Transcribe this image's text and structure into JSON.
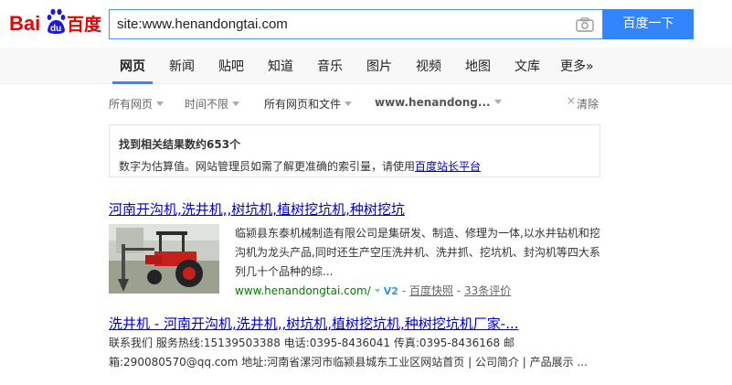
{
  "logo": {
    "text_bai": "Bai",
    "text_du": "du",
    "text_cn": "百度"
  },
  "search": {
    "value": "site:www.henandongtai.com",
    "button_label": "百度一下"
  },
  "icons": {
    "camera": "camera-icon",
    "clear": "close-icon",
    "caret": "caret-down-icon"
  },
  "nav": {
    "items": [
      {
        "label": "网页"
      },
      {
        "label": "新闻"
      },
      {
        "label": "贴吧"
      },
      {
        "label": "知道"
      },
      {
        "label": "音乐"
      },
      {
        "label": "图片"
      },
      {
        "label": "视频"
      },
      {
        "label": "地图"
      },
      {
        "label": "文库"
      },
      {
        "label": "更多»"
      }
    ]
  },
  "filters": {
    "all_pages": "所有网页",
    "time": "时间不限",
    "file_type": "所有网页和文件",
    "site": "www.henandong...",
    "clear_x": "×",
    "clear": "清除"
  },
  "count": {
    "prefix": "找到相关结果数约",
    "number": "653",
    "suffix": "个",
    "note": "数字为估算值。网站管理员如需了解更准确的索引量，请使用",
    "link": "百度站长平台"
  },
  "results": [
    {
      "title": "河南开沟机,洗井机,,树坑机,植树挖坑机,种树挖坑",
      "abstract": "临颍县东泰机械制造有限公司是集研发、制造、修理为一体,以水井钻机和挖沟机为龙头产品,同时还生产空压洗井机、洗井抓、挖坑机、封沟机等四大系列几十个品种的综...",
      "url": "www.henandongtai.com/",
      "badge": "V2",
      "separator": "-",
      "cache": "百度快照",
      "reviews": "33条评价"
    },
    {
      "title": "洗井机 - 河南开沟机,洗井机,,树坑机,植树挖坑机,种树挖坑机厂家-...",
      "body": "联系我们 服务热线:15139503388 电话:0395-8436041 传真:0395-8436168 邮箱:290080570@qq.com 地址:河南省漯河市临颍县城东工业区网站首页 | 公司简介 | 产品展示 ..."
    }
  ],
  "colors": {
    "accent": "#3385ff",
    "link": "#0000cc",
    "url_green": "#008000",
    "logo_red": "#e10602",
    "logo_blue": "#2319dc"
  }
}
